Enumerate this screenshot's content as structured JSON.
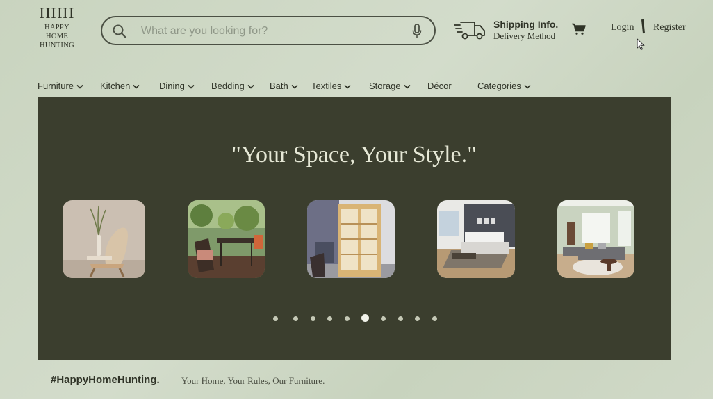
{
  "brand": {
    "mark": "HHH",
    "name_lines": [
      "HAPPY",
      "HOME",
      "HUNTING"
    ]
  },
  "search": {
    "placeholder": "What are you looking for?",
    "value": ""
  },
  "shipping": {
    "title": "Shipping Info.",
    "subtitle": "Delivery Method"
  },
  "auth": {
    "login": "Login",
    "register": "Register"
  },
  "nav": {
    "items": [
      {
        "label": "Furniture",
        "has_dropdown": true
      },
      {
        "label": "Kitchen",
        "has_dropdown": true
      },
      {
        "label": "Dining",
        "has_dropdown": true
      },
      {
        "label": "Bedding",
        "has_dropdown": true
      },
      {
        "label": "Bath",
        "has_dropdown": true
      },
      {
        "label": "Textiles",
        "has_dropdown": true
      },
      {
        "label": "Storage",
        "has_dropdown": true
      },
      {
        "label": "Décor",
        "has_dropdown": false
      },
      {
        "label": "Categories",
        "has_dropdown": true
      }
    ]
  },
  "hero": {
    "quote": "\"Your Space, Your Style.\"",
    "slides": [
      "chair-photo",
      "patio-dining-photo",
      "display-cabinet-photo",
      "bedroom-photo",
      "living-room-photo"
    ],
    "carousel": {
      "total": 10,
      "active_index": 5
    }
  },
  "footer": {
    "hashtag": "#HappyHomeHunting.",
    "slogan": "Your Home, Your Rules, Our Furniture."
  },
  "colors": {
    "background": "#cdd7c4",
    "hero_bg": "#3b3e2e",
    "text": "#2f3327",
    "hero_text": "#e6e8d6"
  },
  "icons": [
    "search-icon",
    "microphone-icon",
    "truck-icon",
    "cart-icon",
    "chevron-down-icon",
    "mouse-pointer-icon"
  ]
}
